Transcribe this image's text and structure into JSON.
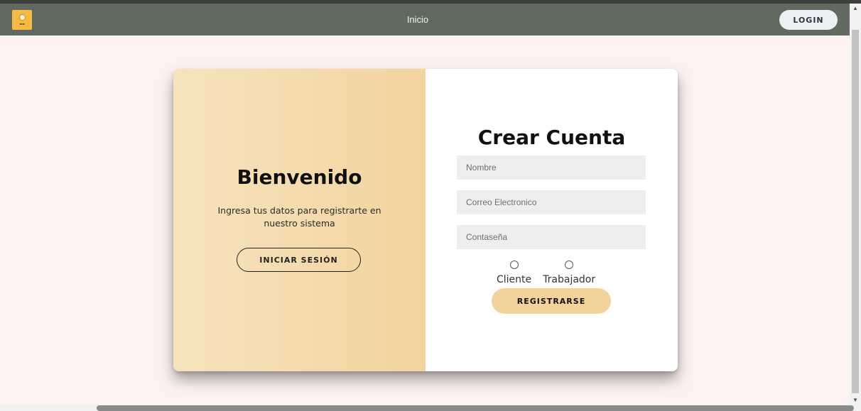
{
  "nav": {
    "logo_icon": "logo-icon",
    "link": "Inicio",
    "login_label": "LOGIN"
  },
  "welcome": {
    "title": "Bienvenido",
    "text": "Ingresa tus datos para registrarte en nuestro sistema",
    "login_button": "INICIAR SESIÓN"
  },
  "register": {
    "title": "Crear Cuenta",
    "fields": {
      "name_placeholder": "Nombre",
      "email_placeholder": "Correo Electronico",
      "password_placeholder": "Contaseña"
    },
    "roles": [
      "Cliente",
      "Trabajador"
    ],
    "submit_label": "REGISTRARSE"
  },
  "colors": {
    "navbar": "#616a5e",
    "page_bg": "#fdf2f1",
    "accent": "#f2d39c"
  }
}
